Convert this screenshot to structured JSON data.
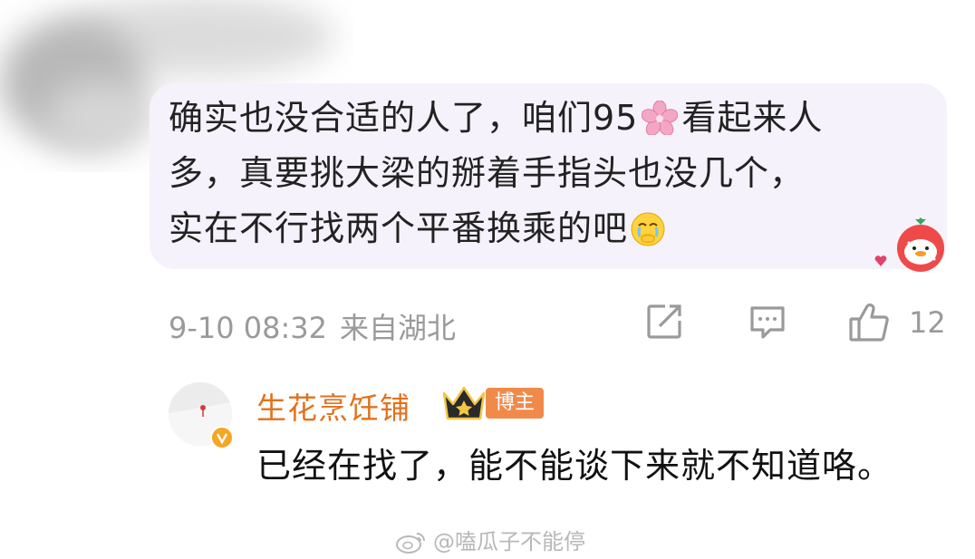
{
  "comment": {
    "line1_before": "确实也没合适的人了，咱们95",
    "line1_after": "看起来人",
    "line2": "多，真要挑大梁的掰着手指头也没几个，",
    "line3": "实在不行找两个平番换乘的吧",
    "date": "9-10 08:32",
    "location": "来自湖北",
    "like_count": "12",
    "emoji_1": "flower-emoji",
    "emoji_2": "crying-face-emoji",
    "sticker": "strawberry-duck-sticker"
  },
  "reply": {
    "name": "生花烹饪铺",
    "badge": "博主",
    "text": "已经在找了，能不能谈下来就不知道咯。"
  },
  "watermark": "@嗑瓜子不能停",
  "colors": {
    "bubble": "#f5f2fb",
    "name": "#e2711d",
    "badge": "#f08a4b",
    "meta": "#9a9a9a"
  }
}
